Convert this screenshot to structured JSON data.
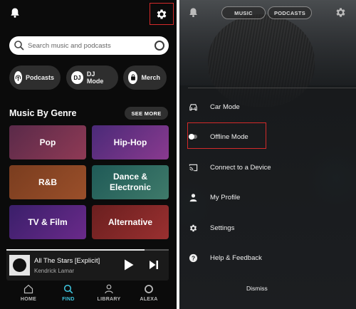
{
  "left": {
    "search": {
      "placeholder": "Search music and podcasts"
    },
    "chips": [
      {
        "label": "Podcasts",
        "icon": "podcast-icon"
      },
      {
        "label": "DJ Mode",
        "icon": "dj-icon",
        "badge": "DJ"
      },
      {
        "label": "Merch",
        "icon": "merch-icon"
      }
    ],
    "section_title": "Music By Genre",
    "see_more": "SEE MORE",
    "genres": [
      "Pop",
      "Hip-Hop",
      "R&B",
      "Dance & Electronic",
      "TV & Film",
      "Alternative"
    ],
    "now_playing": {
      "title": "All The Stars [Explicit]",
      "artist": "Kendrick Lamar",
      "progress": 0.85
    },
    "nav": [
      "HOME",
      "FIND",
      "LIBRARY",
      "ALEXA"
    ],
    "active_nav": "FIND",
    "accent_color": "#3fc7e0",
    "highlight_color": "#d42a2a"
  },
  "right": {
    "pills": [
      "MUSIC",
      "PODCASTS"
    ],
    "menu": [
      {
        "label": "Car Mode",
        "icon": "car-icon"
      },
      {
        "label": "Offline Mode",
        "icon": "toggle-icon"
      },
      {
        "label": "Connect to a Device",
        "icon": "cast-icon"
      },
      {
        "label": "My Profile",
        "icon": "person-icon"
      },
      {
        "label": "Settings",
        "icon": "gear-icon"
      },
      {
        "label": "Help & Feedback",
        "icon": "help-icon"
      }
    ],
    "dismiss": "Dismiss"
  }
}
